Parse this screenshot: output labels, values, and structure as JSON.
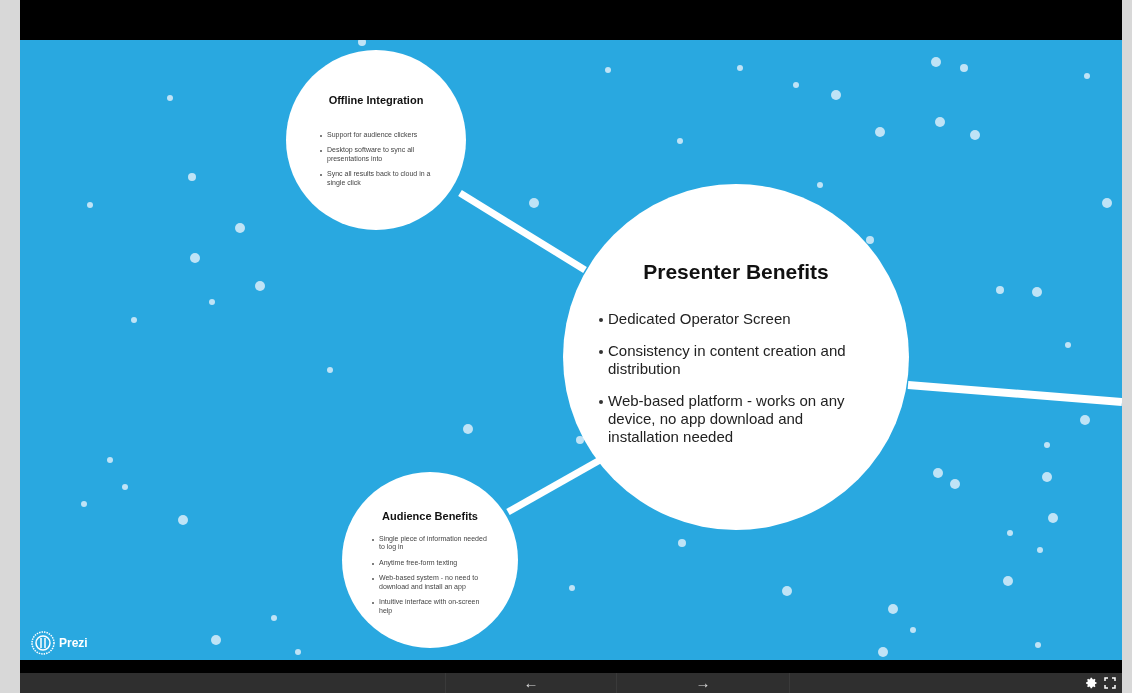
{
  "topics": [
    {
      "kind": "small",
      "title": "Offline Integration",
      "bullets": [
        "Support for audience clickers",
        "Desktop software to sync all presentations into",
        "Sync all results back to cloud in a single click"
      ]
    },
    {
      "kind": "large",
      "title": "Presenter Benefits",
      "bullets": [
        "Dedicated Operator Screen",
        "Consistency in content creation and distribution",
        "Web-based platform - works on any device, no app download and installation needed"
      ]
    },
    {
      "kind": "small",
      "title": "Audience Benefits",
      "bullets": [
        "Single piece of information needed to log in",
        "Anytime free-form texting",
        "Web-based system - no need to download and install an app",
        "Intuitive interface with on-screen help"
      ]
    }
  ],
  "logo": {
    "text": "Prezi"
  },
  "controls": {
    "previous": "←",
    "next": "→"
  }
}
